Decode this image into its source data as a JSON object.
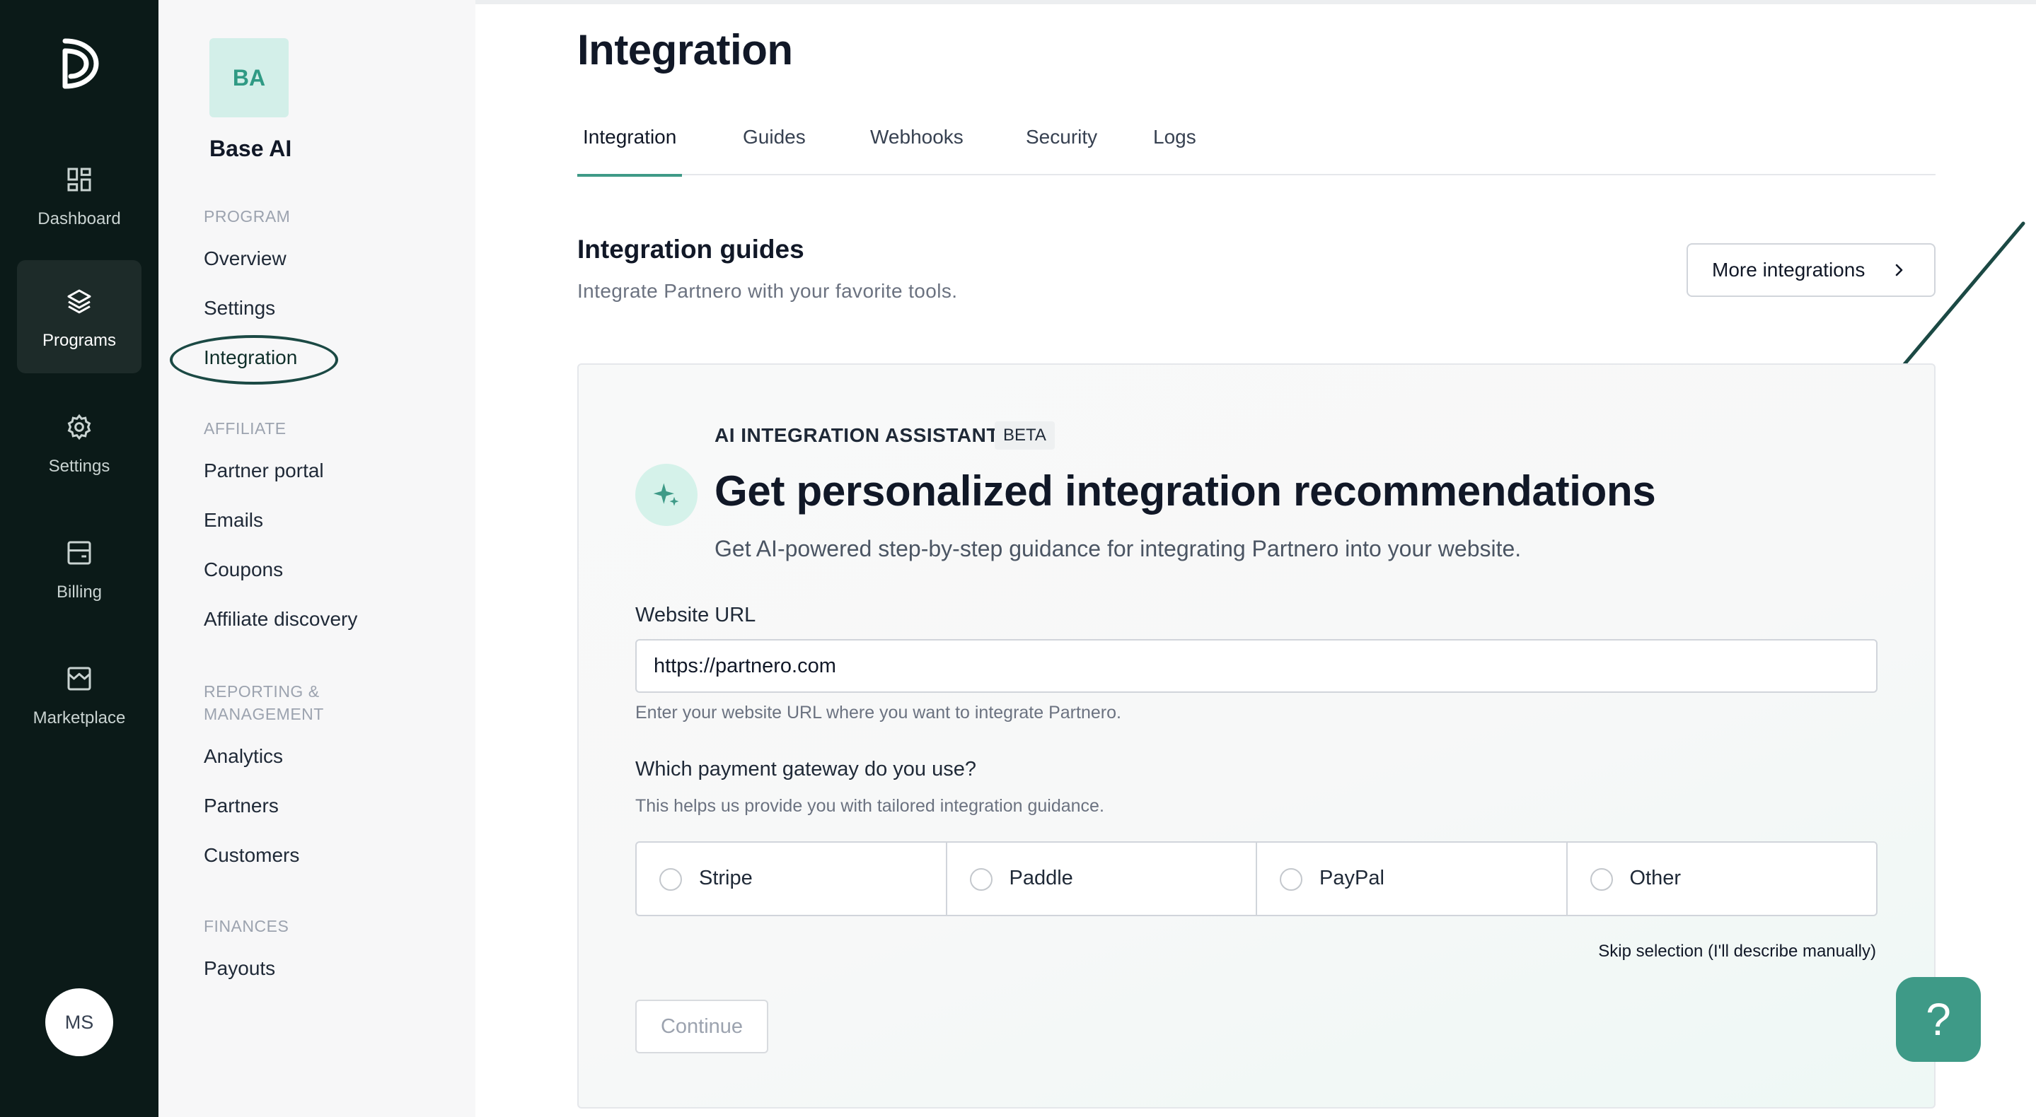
{
  "rail": {
    "items": [
      {
        "label": "Dashboard",
        "icon": "dashboard-icon"
      },
      {
        "label": "Programs",
        "icon": "layers-icon",
        "active": true
      },
      {
        "label": "Settings",
        "icon": "gear-icon"
      },
      {
        "label": "Billing",
        "icon": "billing-icon"
      },
      {
        "label": "Marketplace",
        "icon": "store-icon"
      }
    ],
    "avatar": "MS"
  },
  "sidebar": {
    "org_badge": "BA",
    "org_name": "Base AI",
    "sections": [
      {
        "title": "PROGRAM",
        "items": [
          "Overview",
          "Settings",
          "Integration"
        ]
      },
      {
        "title": "AFFILIATE",
        "items": [
          "Partner portal",
          "Emails",
          "Coupons",
          "Affiliate discovery"
        ]
      },
      {
        "title_line1": "REPORTING &",
        "title_line2": "MANAGEMENT",
        "items": [
          "Analytics",
          "Partners",
          "Customers"
        ]
      },
      {
        "title": "FINANCES",
        "items": [
          "Payouts"
        ]
      }
    ],
    "active_item": "Integration"
  },
  "main": {
    "title": "Integration",
    "tabs": [
      "Integration",
      "Guides",
      "Webhooks",
      "Security",
      "Logs"
    ],
    "active_tab": "Integration",
    "section_title": "Integration guides",
    "section_subtitle": "Integrate Partnero with your favorite tools.",
    "more_button": "More integrations"
  },
  "assistant": {
    "eyebrow": "AI INTEGRATION ASSISTANT",
    "badge": "BETA",
    "title": "Get personalized integration recommendations",
    "subtitle": "Get AI-powered step-by-step guidance for integrating Partnero into your website.",
    "url_label": "Website URL",
    "url_value": "https://partnero.com",
    "url_hint": "Enter your website URL where you want to integrate Partnero.",
    "gateway_label": "Which payment gateway do you use?",
    "gateway_hint": "This helps us provide you with tailored integration guidance.",
    "gateways": [
      "Stripe",
      "Paddle",
      "PayPal",
      "Other"
    ],
    "skip_link": "Skip selection (I'll describe manually)",
    "continue_button": "Continue"
  },
  "help_button": "?",
  "colors": {
    "rail_bg": "#0b1a18",
    "accent": "#3e9a87",
    "badge_bg": "#d3efe9"
  }
}
